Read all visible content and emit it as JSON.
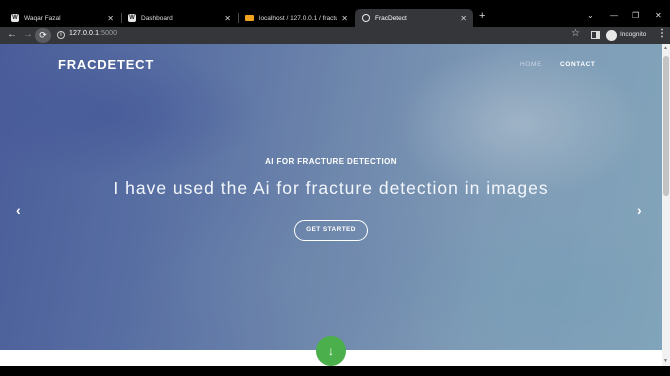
{
  "browser": {
    "tabs": [
      {
        "title": "Waqar Fazal",
        "favicon": "W",
        "active": false
      },
      {
        "title": "Dashboard",
        "favicon": "W",
        "active": false
      },
      {
        "title": "localhost / 127.0.0.1 / fracture / ...",
        "favicon": "db",
        "active": false
      },
      {
        "title": "FracDetect",
        "favicon": "globe",
        "active": true
      }
    ],
    "close_glyph": "✕",
    "new_tab_glyph": "+",
    "url_host": "127.0.0.1",
    "url_port": ":5000",
    "profile_label": "Incognito",
    "window_controls": {
      "dropdown": "⌄",
      "minimize": "—",
      "restore": "❐",
      "close": "✕"
    }
  },
  "site": {
    "brand": "FRACDETECT",
    "nav": [
      {
        "label": "HOME",
        "active": false
      },
      {
        "label": "CONTACT",
        "active": true
      }
    ],
    "hero": {
      "kicker": "AI FOR FRACTURE DETECTION",
      "headline": "I have used the Ai for fracture detection in images",
      "cta_label": "GET STARTED",
      "prev_glyph": "‹",
      "next_glyph": "›"
    },
    "scroll_down_glyph": "↓",
    "colors": {
      "accent_green": "#4bb04b",
      "hero_blue": "#5f78ad",
      "hero_teal": "#8fb5c8"
    }
  }
}
